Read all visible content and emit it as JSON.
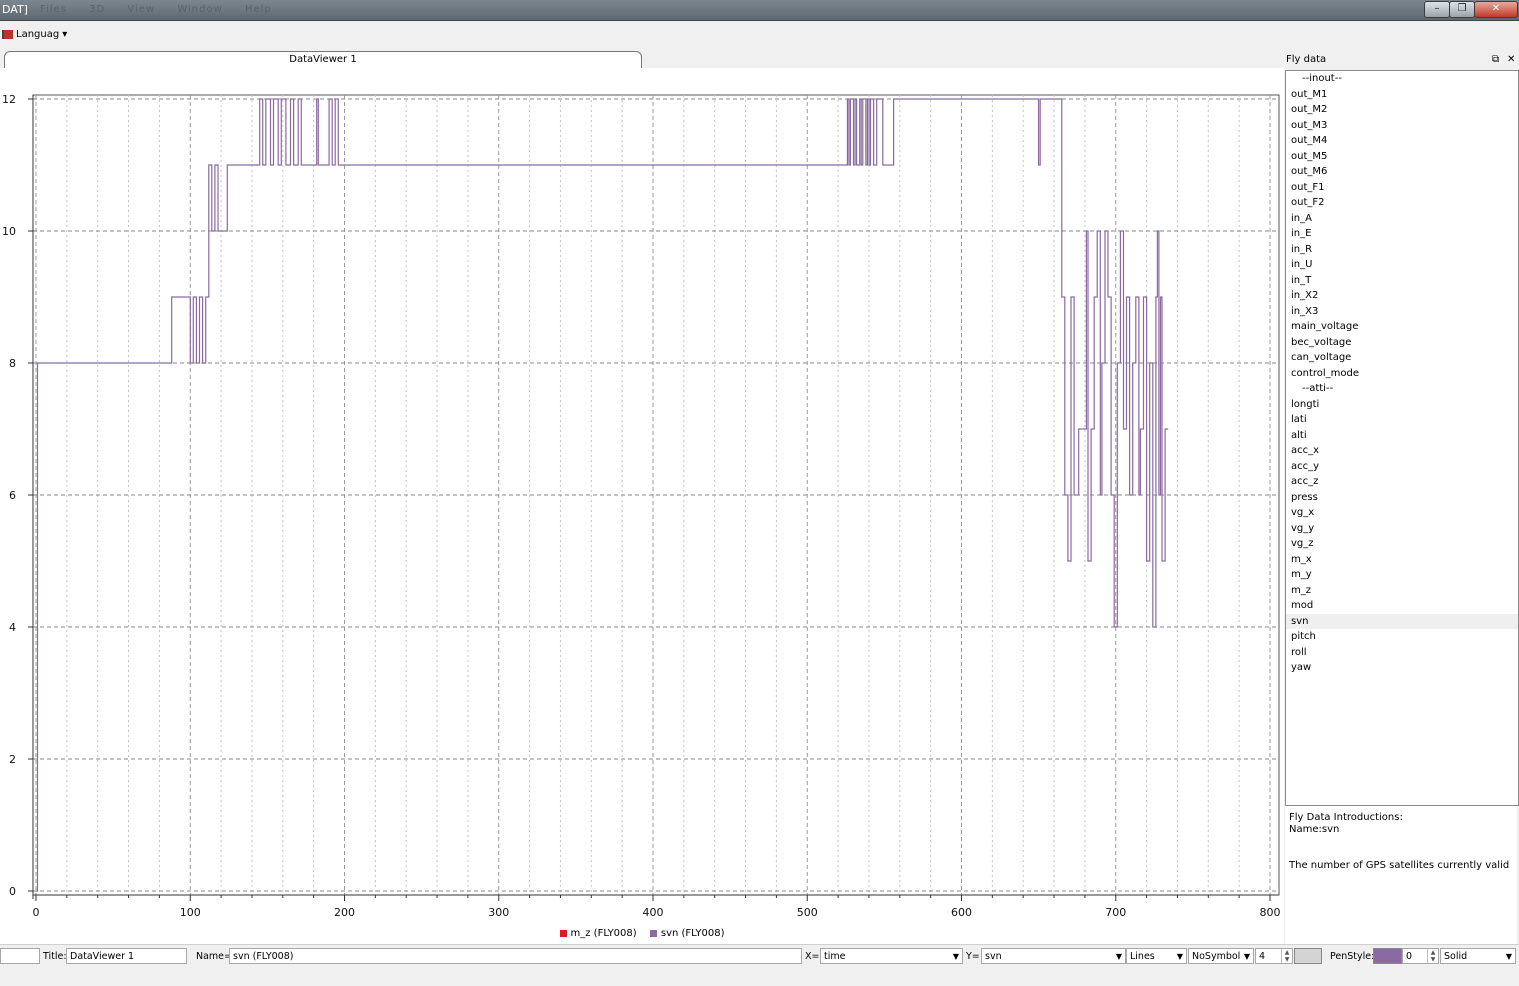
{
  "window": {
    "title": "DAT]",
    "menus": [
      "",
      "Files",
      "3D",
      "View",
      "Window",
      "Help"
    ],
    "minimize_label": "–",
    "maximize_label": "❐",
    "close_label": "✕"
  },
  "toolbar": {
    "language_label": "Languag",
    "dropdown_icon": "▾"
  },
  "tab": {
    "label": "DataViewer 1"
  },
  "chart_data": {
    "type": "line",
    "title": "",
    "xlabel": "",
    "ylabel": "",
    "xlim": [
      0,
      800
    ],
    "ylim": [
      0,
      12
    ],
    "grid": true,
    "x_ticks": [
      0,
      100,
      200,
      300,
      400,
      500,
      600,
      700,
      800
    ],
    "y_ticks": [
      0,
      2,
      4,
      6,
      8,
      10,
      12
    ],
    "legend_position": "bottom-center",
    "legend": [
      {
        "name": "m_z (FLY008)",
        "color": "#d42020"
      },
      {
        "name": "svn (FLY008)",
        "color": "#8a6aa0"
      }
    ],
    "series": [
      {
        "name": "svn (FLY008)",
        "color": "#8a6aa0",
        "x": [
          0,
          1,
          1,
          88,
          88,
          100,
          100,
          102,
          102,
          104,
          104,
          106,
          106,
          108,
          108,
          110,
          110,
          112,
          112,
          114,
          114,
          116,
          116,
          118,
          118,
          124,
          124,
          145,
          145,
          147,
          147,
          149,
          149,
          152,
          152,
          154,
          154,
          157,
          157,
          159,
          159,
          162,
          162,
          165,
          165,
          167,
          167,
          170,
          170,
          172,
          172,
          182,
          182,
          183,
          183,
          190,
          190,
          192,
          192,
          194,
          194,
          196,
          196,
          526,
          526,
          527,
          527,
          528,
          528,
          530,
          530,
          531,
          531,
          532,
          532,
          534,
          534,
          535,
          535,
          536,
          536,
          538,
          538,
          539,
          539,
          540,
          540,
          541,
          541,
          543,
          543,
          545,
          545,
          549,
          549,
          556,
          556,
          650,
          650,
          651,
          651,
          665,
          665,
          667,
          667,
          669,
          669,
          671,
          671,
          673,
          673,
          676,
          676,
          681,
          681,
          682,
          682,
          684,
          684,
          686,
          686,
          688,
          688,
          690,
          690,
          691,
          691,
          693,
          693,
          695,
          695,
          697,
          697,
          699,
          699,
          701,
          701,
          703,
          703,
          705,
          705,
          707,
          707,
          709,
          709,
          711,
          711,
          713,
          713,
          715,
          715,
          716,
          716,
          718,
          718,
          720,
          720,
          722,
          722,
          724,
          724,
          726,
          726,
          727,
          727,
          728,
          728,
          729,
          729,
          730,
          730,
          732,
          732,
          734
        ],
        "y": [
          0,
          0,
          8,
          8,
          9,
          9,
          8,
          8,
          9,
          9,
          8,
          8,
          9,
          9,
          8,
          8,
          9,
          9,
          11,
          11,
          10,
          10,
          11,
          11,
          10,
          10,
          11,
          11,
          12,
          12,
          11,
          11,
          12,
          12,
          11,
          11,
          12,
          12,
          11,
          11,
          12,
          12,
          11,
          11,
          12,
          12,
          11,
          11,
          12,
          12,
          11,
          11,
          12,
          12,
          11,
          11,
          12,
          12,
          11,
          11,
          12,
          12,
          11,
          11,
          12,
          12,
          11,
          11,
          12,
          12,
          11,
          11,
          12,
          12,
          11,
          11,
          12,
          12,
          11,
          11,
          12,
          12,
          11,
          11,
          12,
          12,
          11,
          11,
          12,
          12,
          11,
          11,
          12,
          12,
          11,
          11,
          12,
          12,
          11,
          11,
          12,
          12,
          9,
          9,
          6,
          6,
          5,
          5,
          9,
          9,
          6,
          6,
          7,
          7,
          10,
          10,
          5,
          5,
          7,
          7,
          9,
          9,
          10,
          10,
          6,
          6,
          8,
          8,
          10,
          10,
          9,
          9,
          6,
          6,
          4,
          4,
          8,
          8,
          10,
          10,
          7,
          7,
          9,
          9,
          6,
          6,
          8,
          8,
          9,
          9,
          6,
          6,
          7,
          7,
          9,
          9,
          5,
          5,
          8,
          8,
          4,
          4,
          9,
          9,
          10,
          10,
          6,
          6,
          9,
          9,
          5,
          5,
          7,
          7
        ]
      }
    ]
  },
  "panel": {
    "title": "Fly data",
    "float_icon": "⧉",
    "close_icon": "✕",
    "items": [
      "--inout--",
      "out_M1",
      "out_M2",
      "out_M3",
      "out_M4",
      "out_M5",
      "out_M6",
      "out_F1",
      "out_F2",
      "in_A",
      "in_E",
      "in_R",
      "in_U",
      "in_T",
      "in_X2",
      "in_X3",
      "main_voltage",
      "bec_voltage",
      "can_voltage",
      "control_mode",
      "--atti--",
      "longti",
      "lati",
      "alti",
      "acc_x",
      "acc_y",
      "acc_z",
      "press",
      "vg_x",
      "vg_y",
      "vg_z",
      "m_x",
      "m_y",
      "m_z",
      "mod",
      "svn",
      "pitch",
      "roll",
      "yaw"
    ],
    "selected": "svn",
    "intro_heading": "Fly Data Introductions:",
    "intro_name": "Name:svn",
    "intro_text": "The number of GPS satellites currently valid"
  },
  "status": {
    "title_label": "Title:",
    "title_value": "DataViewer 1",
    "name_label": "Name=",
    "name_value": "svn (FLY008)",
    "x_label": "X=",
    "x_value": "time",
    "y_label": "Y=",
    "y_value": "svn",
    "style_value": "Lines",
    "symbol_value": "NoSymbol",
    "size_value": "4",
    "penstyle_label": "PenStyle:",
    "pen_width_value": "0",
    "pen_line_value": "Solid",
    "pen_color": "#8a6aa0"
  }
}
